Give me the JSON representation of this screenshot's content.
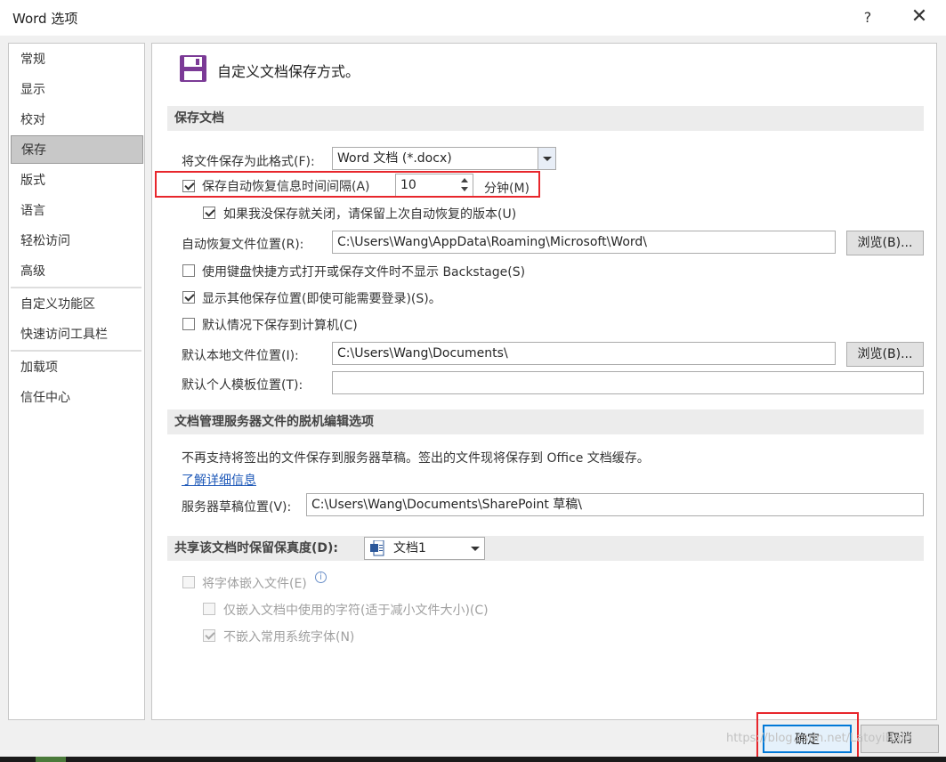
{
  "window": {
    "title": "Word 选项",
    "help": "?",
    "close": "✕"
  },
  "sidebar": {
    "items": [
      {
        "label": "常规"
      },
      {
        "label": "显示"
      },
      {
        "label": "校对"
      },
      {
        "label": "保存",
        "selected": true
      },
      {
        "label": "版式"
      },
      {
        "label": "语言"
      },
      {
        "label": "轻松访问"
      },
      {
        "label": "高级"
      },
      {
        "label": "自定义功能区"
      },
      {
        "label": "快速访问工具栏"
      },
      {
        "label": "加载项"
      },
      {
        "label": "信任中心"
      }
    ]
  },
  "header": {
    "text": "自定义文档保存方式。",
    "icon": "floppy-disk-icon",
    "icon_color": "#7b3a96"
  },
  "save_section": {
    "title": "保存文档",
    "format_label": "将文件保存为此格式(F):",
    "format_value": "Word 文档 (*.docx)",
    "autorecover_label": "保存自动恢复信息时间间隔(A)",
    "autorecover_checked": true,
    "autorecover_minutes": "10",
    "minutes_label": "分钟(M)",
    "keep_last_label": "如果我没保存就关闭，请保留上次自动恢复的版本(U)",
    "keep_last_checked": true,
    "autorecover_location_label": "自动恢复文件位置(R):",
    "autorecover_location_value": "C:\\Users\\Wang\\AppData\\Roaming\\Microsoft\\Word\\",
    "browse1": "浏览(B)...",
    "no_backstage_label": "使用键盘快捷方式打开或保存文件时不显示 Backstage(S)",
    "no_backstage_checked": false,
    "show_other_label": "显示其他保存位置(即使可能需要登录)(S)。",
    "show_other_checked": true,
    "default_computer_label": "默认情况下保存到计算机(C)",
    "default_computer_checked": false,
    "default_local_label": "默认本地文件位置(I):",
    "default_local_value": "C:\\Users\\Wang\\Documents\\",
    "browse2": "浏览(B)...",
    "template_label": "默认个人模板位置(T):",
    "template_value": ""
  },
  "offline_section": {
    "title": "文档管理服务器文件的脱机编辑选项",
    "notice": "不再支持将签出的文件保存到服务器草稿。签出的文件现将保存到 Office 文档缓存。",
    "learn_more": "了解详细信息",
    "drafts_label": "服务器草稿位置(V):",
    "drafts_value": "C:\\Users\\Wang\\Documents\\SharePoint 草稿\\"
  },
  "fidelity_section": {
    "title": "共享该文档时保留保真度(D):",
    "document": "文档1",
    "embed_fonts_label": "将字体嵌入文件(E)",
    "embed_fonts_checked": false,
    "embed_used_label": "仅嵌入文档中使用的字符(适于减小文件大小)(C)",
    "embed_used_checked": false,
    "no_common_label": "不嵌入常用系统字体(N)",
    "no_common_checked": true
  },
  "footer": {
    "ok": "确定",
    "cancel": "取消"
  },
  "watermark": "https://blog.csdn.net/LatoyiHale",
  "colors": {
    "highlight_red": "#e8262c",
    "link_blue": "#1d58b8"
  }
}
